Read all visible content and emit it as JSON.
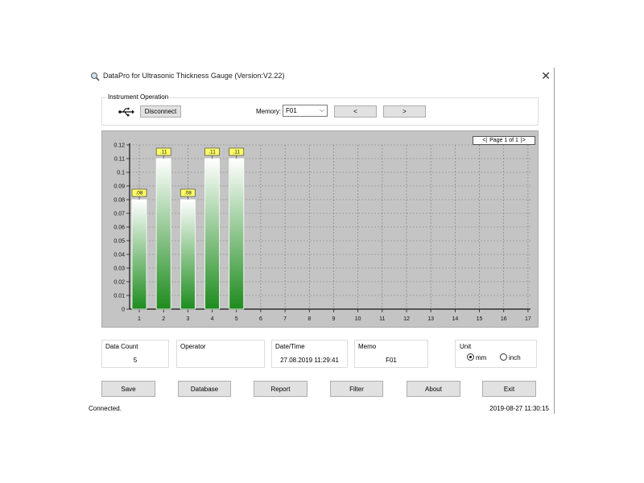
{
  "window": {
    "title": "DataPro for Ultrasonic Thickness Gauge (Version:V2.22)",
    "close_glyph": "✕"
  },
  "instrument": {
    "group_label": "Instrument Operation",
    "connection_icon": "usb-icon",
    "disconnect_label": "Disconnect",
    "memory_label": "Memory:",
    "memory_value": "F01",
    "prev_label": "<",
    "next_label": ">"
  },
  "chart_data": {
    "type": "bar",
    "categories": [
      "1",
      "2",
      "3",
      "4",
      "5",
      "6",
      "7",
      "8",
      "9",
      "10",
      "11",
      "12",
      "13",
      "14",
      "15",
      "16",
      "17"
    ],
    "values": [
      0.08,
      0.11,
      0.08,
      0.11,
      0.11,
      null,
      null,
      null,
      null,
      null,
      null,
      null,
      null,
      null,
      null,
      null,
      null
    ],
    "data_labels": [
      ".08",
      ".11",
      ".08",
      ".11",
      ".11"
    ],
    "y_ticks": [
      "0",
      "0.01",
      "0.02",
      "0.03",
      "0.04",
      "0.05",
      "0.06",
      "0.07",
      "0.08",
      "0.09",
      "0.1",
      "0.11",
      "0.12"
    ],
    "ylim": [
      0,
      0.12
    ],
    "grid": true,
    "title": "",
    "xlabel": "",
    "ylabel": "",
    "colors": {
      "bar_top": "#ffffff",
      "bar_bottom": "#1e8c1e",
      "label_bg": "#ffff66",
      "background": "#c4c4c4"
    }
  },
  "pager": {
    "text": "Page 1 of 1"
  },
  "info": {
    "data_count_label": "Data Count",
    "data_count_value": "5",
    "operator_label": "Operator",
    "operator_value": "",
    "datetime_label": "Date/Time",
    "datetime_value": "27.08.2019 11:29:41",
    "memo_label": "Memo",
    "memo_value": "F01",
    "unit_label": "Unit",
    "unit_mm": "mm",
    "unit_inch": "inch",
    "unit_selected": "mm"
  },
  "buttons": {
    "save": "Save",
    "database": "Database",
    "report": "Report",
    "filter": "Filter",
    "about": "About",
    "exit": "Exit"
  },
  "status": {
    "left": "Connected.",
    "right": "2019-08-27 11:30:15"
  }
}
